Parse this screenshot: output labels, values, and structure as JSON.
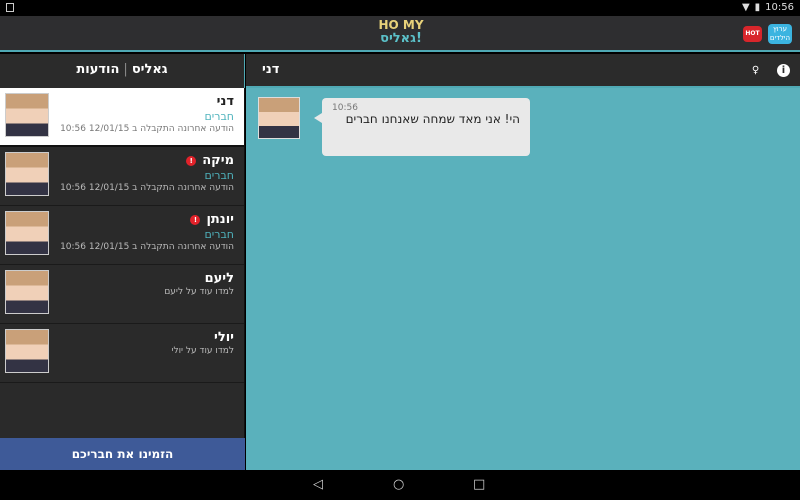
{
  "status_bar": {
    "time": "10:56"
  },
  "app_bar": {
    "logo_text": "HO MY",
    "logo_sub": "גאליס!",
    "brand_kids": "ערוץ הילדים",
    "brand_hot": "HOT"
  },
  "left_header": {
    "title_a": "גאליס",
    "separator": "|",
    "title_b": "הודעות"
  },
  "chat_header": {
    "name": "דני"
  },
  "contacts": [
    {
      "name": "דני",
      "group": "חברים",
      "meta": "הודעה אחרונה התקבלה ב 12/01/15 10:56",
      "badge": "",
      "selected": true
    },
    {
      "name": "מיקה",
      "group": "חברים",
      "meta": "הודעה אחרונה התקבלה ב 12/01/15 10:56",
      "badge": "!"
    },
    {
      "name": "יונתן",
      "group": "חברים",
      "meta": "הודעה אחרונה התקבלה ב 12/01/15 10:56",
      "badge": "!"
    },
    {
      "name": "ליעם",
      "group": "",
      "meta": "למדו עוד על ליעם",
      "badge": ""
    },
    {
      "name": "יולי",
      "group": "",
      "meta": "למדו עוד על יולי",
      "badge": ""
    }
  ],
  "invite_button": "הזמינו את חבריכם",
  "messages": [
    {
      "time": "10:56",
      "text": "הי! אני מאד שמחה שאנחנו חברים"
    }
  ],
  "nav": {
    "back": "◁",
    "home": "○",
    "recents": "□"
  }
}
